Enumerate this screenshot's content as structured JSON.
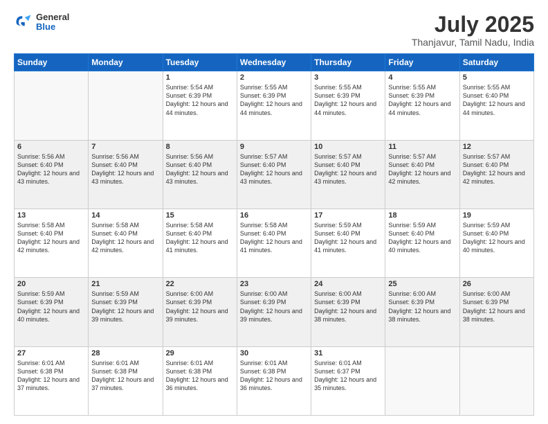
{
  "header": {
    "logo_general": "General",
    "logo_blue": "Blue",
    "title": "July 2025",
    "subtitle": "Thanjavur, Tamil Nadu, India"
  },
  "weekdays": [
    "Sunday",
    "Monday",
    "Tuesday",
    "Wednesday",
    "Thursday",
    "Friday",
    "Saturday"
  ],
  "weeks": [
    [
      {
        "day": "",
        "text": ""
      },
      {
        "day": "",
        "text": ""
      },
      {
        "day": "1",
        "text": "Sunrise: 5:54 AM\nSunset: 6:39 PM\nDaylight: 12 hours and 44 minutes."
      },
      {
        "day": "2",
        "text": "Sunrise: 5:55 AM\nSunset: 6:39 PM\nDaylight: 12 hours and 44 minutes."
      },
      {
        "day": "3",
        "text": "Sunrise: 5:55 AM\nSunset: 6:39 PM\nDaylight: 12 hours and 44 minutes."
      },
      {
        "day": "4",
        "text": "Sunrise: 5:55 AM\nSunset: 6:39 PM\nDaylight: 12 hours and 44 minutes."
      },
      {
        "day": "5",
        "text": "Sunrise: 5:55 AM\nSunset: 6:40 PM\nDaylight: 12 hours and 44 minutes."
      }
    ],
    [
      {
        "day": "6",
        "text": "Sunrise: 5:56 AM\nSunset: 6:40 PM\nDaylight: 12 hours and 43 minutes."
      },
      {
        "day": "7",
        "text": "Sunrise: 5:56 AM\nSunset: 6:40 PM\nDaylight: 12 hours and 43 minutes."
      },
      {
        "day": "8",
        "text": "Sunrise: 5:56 AM\nSunset: 6:40 PM\nDaylight: 12 hours and 43 minutes."
      },
      {
        "day": "9",
        "text": "Sunrise: 5:57 AM\nSunset: 6:40 PM\nDaylight: 12 hours and 43 minutes."
      },
      {
        "day": "10",
        "text": "Sunrise: 5:57 AM\nSunset: 6:40 PM\nDaylight: 12 hours and 43 minutes."
      },
      {
        "day": "11",
        "text": "Sunrise: 5:57 AM\nSunset: 6:40 PM\nDaylight: 12 hours and 42 minutes."
      },
      {
        "day": "12",
        "text": "Sunrise: 5:57 AM\nSunset: 6:40 PM\nDaylight: 12 hours and 42 minutes."
      }
    ],
    [
      {
        "day": "13",
        "text": "Sunrise: 5:58 AM\nSunset: 6:40 PM\nDaylight: 12 hours and 42 minutes."
      },
      {
        "day": "14",
        "text": "Sunrise: 5:58 AM\nSunset: 6:40 PM\nDaylight: 12 hours and 42 minutes."
      },
      {
        "day": "15",
        "text": "Sunrise: 5:58 AM\nSunset: 6:40 PM\nDaylight: 12 hours and 41 minutes."
      },
      {
        "day": "16",
        "text": "Sunrise: 5:58 AM\nSunset: 6:40 PM\nDaylight: 12 hours and 41 minutes."
      },
      {
        "day": "17",
        "text": "Sunrise: 5:59 AM\nSunset: 6:40 PM\nDaylight: 12 hours and 41 minutes."
      },
      {
        "day": "18",
        "text": "Sunrise: 5:59 AM\nSunset: 6:40 PM\nDaylight: 12 hours and 40 minutes."
      },
      {
        "day": "19",
        "text": "Sunrise: 5:59 AM\nSunset: 6:40 PM\nDaylight: 12 hours and 40 minutes."
      }
    ],
    [
      {
        "day": "20",
        "text": "Sunrise: 5:59 AM\nSunset: 6:39 PM\nDaylight: 12 hours and 40 minutes."
      },
      {
        "day": "21",
        "text": "Sunrise: 5:59 AM\nSunset: 6:39 PM\nDaylight: 12 hours and 39 minutes."
      },
      {
        "day": "22",
        "text": "Sunrise: 6:00 AM\nSunset: 6:39 PM\nDaylight: 12 hours and 39 minutes."
      },
      {
        "day": "23",
        "text": "Sunrise: 6:00 AM\nSunset: 6:39 PM\nDaylight: 12 hours and 39 minutes."
      },
      {
        "day": "24",
        "text": "Sunrise: 6:00 AM\nSunset: 6:39 PM\nDaylight: 12 hours and 38 minutes."
      },
      {
        "day": "25",
        "text": "Sunrise: 6:00 AM\nSunset: 6:39 PM\nDaylight: 12 hours and 38 minutes."
      },
      {
        "day": "26",
        "text": "Sunrise: 6:00 AM\nSunset: 6:39 PM\nDaylight: 12 hours and 38 minutes."
      }
    ],
    [
      {
        "day": "27",
        "text": "Sunrise: 6:01 AM\nSunset: 6:38 PM\nDaylight: 12 hours and 37 minutes."
      },
      {
        "day": "28",
        "text": "Sunrise: 6:01 AM\nSunset: 6:38 PM\nDaylight: 12 hours and 37 minutes."
      },
      {
        "day": "29",
        "text": "Sunrise: 6:01 AM\nSunset: 6:38 PM\nDaylight: 12 hours and 36 minutes."
      },
      {
        "day": "30",
        "text": "Sunrise: 6:01 AM\nSunset: 6:38 PM\nDaylight: 12 hours and 36 minutes."
      },
      {
        "day": "31",
        "text": "Sunrise: 6:01 AM\nSunset: 6:37 PM\nDaylight: 12 hours and 35 minutes."
      },
      {
        "day": "",
        "text": ""
      },
      {
        "day": "",
        "text": ""
      }
    ]
  ]
}
